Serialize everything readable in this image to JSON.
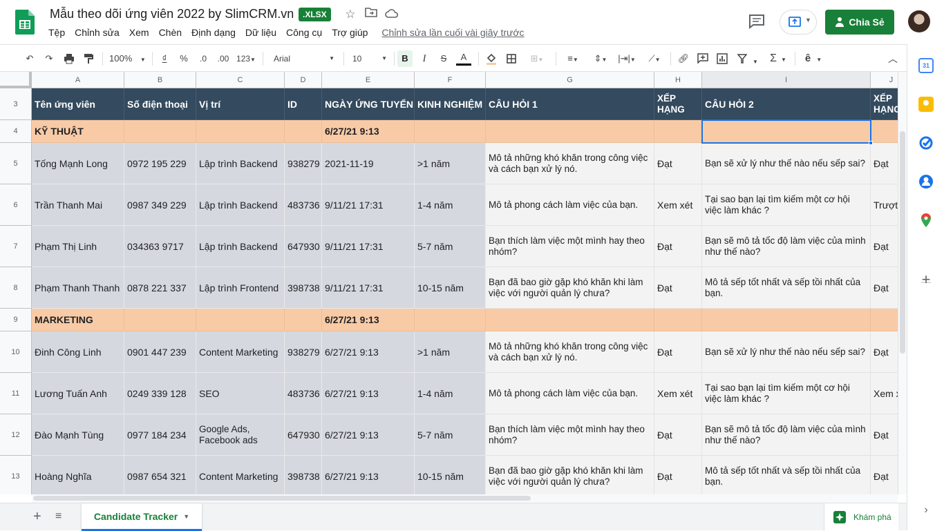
{
  "doc": {
    "title": "Mẫu theo dõi ứng viên 2022 by SlimCRM.vn",
    "badge": ".XLSX",
    "last_edit": "Chỉnh sửa lần cuối vài giây trước"
  },
  "menu": [
    "Tệp",
    "Chỉnh sửa",
    "Xem",
    "Chèn",
    "Định dạng",
    "Dữ liệu",
    "Công cụ",
    "Trợ giúp"
  ],
  "share_label": "Chia Sẻ",
  "toolbar": {
    "zoom": "100%",
    "currency": "₫",
    "percent": "%",
    "dec_less": ".0",
    "dec_more": ".00",
    "format_more": "123",
    "font": "Arial",
    "font_size": "10",
    "bold": "B",
    "italic": "I",
    "strike": "S",
    "textcolor": "A"
  },
  "columns": [
    "A",
    "B",
    "C",
    "D",
    "E",
    "F",
    "G",
    "H",
    "I",
    "J"
  ],
  "row_numbers": [
    "3",
    "4",
    "5",
    "6",
    "7",
    "8",
    "9",
    "10",
    "11",
    "12",
    "13"
  ],
  "header_row": [
    "Tên ứng viên",
    "Số điện thoại",
    "Vị trí",
    "ID",
    "NGÀY ỨNG TUYỂN",
    "KINH NGHIỆM",
    "CÂU HỎI 1",
    "XẾP HẠNG",
    "CÂU HỎI 2",
    "XẾP HẠNG"
  ],
  "sections": [
    {
      "name": "KỸ THUẬT",
      "date": "6/27/21 9:13",
      "rows": [
        [
          "Tống Mạnh Long",
          "0972 195 229",
          "Lập trình Backend",
          "938279",
          "2021-11-19",
          ">1 năm",
          "Mô tả những khó khăn trong công việc và cách bạn xử lý nó.",
          "Đạt",
          "Bạn sẽ xử lý như thế nào nếu sếp sai?",
          "Đạt"
        ],
        [
          "Trần Thanh Mai",
          "0987 349 229",
          "Lập trình Backend",
          "483736",
          "9/11/21 17:31",
          "1-4 năm",
          "Mô tả phong cách làm việc của bạn.",
          "Xem xét",
          "Tại sao bạn lại tìm kiếm một cơ hội việc làm khác  ?",
          "Trượt"
        ],
        [
          "Phạm Thị Linh",
          "034363 9717",
          "Lập trình Backend",
          "647930",
          "9/11/21 17:31",
          "5-7 năm",
          "Bạn thích làm việc một mình hay theo nhóm?",
          "Đạt",
          "Bạn sẽ mô tả tốc độ làm việc của mình như thế nào?",
          "Đạt"
        ],
        [
          "Phạm Thanh Thanh",
          "0878 221 337",
          "Lập trình Frontend",
          "398738",
          "9/11/21 17:31",
          "10-15 năm",
          "Bạn đã bao giờ gặp khó khăn khi làm việc với người quản lý chưa?",
          "Đạt",
          "Mô tả sếp tốt nhất và sếp tồi nhất của bạn.",
          "Đạt"
        ]
      ]
    },
    {
      "name": "MARKETING",
      "date": "6/27/21 9:13",
      "rows": [
        [
          "Đinh Công Linh",
          "0901 447 239",
          "Content Marketing",
          "938279",
          "6/27/21 9:13",
          ">1 năm",
          "Mô tả những khó khăn trong công việc và cách bạn xử lý nó.",
          "Đạt",
          "Bạn sẽ xử lý như thế nào nếu sếp sai?",
          "Đạt"
        ],
        [
          "Lương Tuấn Anh",
          "0249 339 128",
          "SEO",
          "483736",
          "6/27/21 9:13",
          "1-4 năm",
          "Mô tả phong cách làm việc của bạn.",
          "Xem xét",
          "Tại sao bạn lại tìm kiếm một cơ hội việc làm khác  ?",
          "Xem x"
        ],
        [
          "Đào Mạnh Tùng",
          "0977 184 234",
          "Google Ads, Facebook ads",
          "647930",
          "6/27/21 9:13",
          "5-7 năm",
          "Bạn thích làm việc một mình hay theo nhóm?",
          "Đạt",
          "Bạn sẽ mô tả tốc độ làm việc của mình như thế nào?",
          "Đạt"
        ],
        [
          "Hoàng Nghĩa",
          "0987 654 321",
          "Content Marketing",
          "398738",
          "6/27/21 9:13",
          "10-15 năm",
          "Bạn đã bao giờ gặp khó khăn khi làm việc với người quản lý chưa?",
          "Đạt",
          "Mô tả sếp tốt nhất và sếp tồi nhất của bạn.",
          "Đạt"
        ]
      ]
    }
  ],
  "sheet_tab": "Candidate Tracker",
  "explore_label": "Khám phá",
  "colors": {
    "header_bg": "#344a5e",
    "section_bg": "#f8cba6",
    "gray_col": "#d5d9df",
    "brand_green": "#188038",
    "selection": "#1a73e8"
  }
}
